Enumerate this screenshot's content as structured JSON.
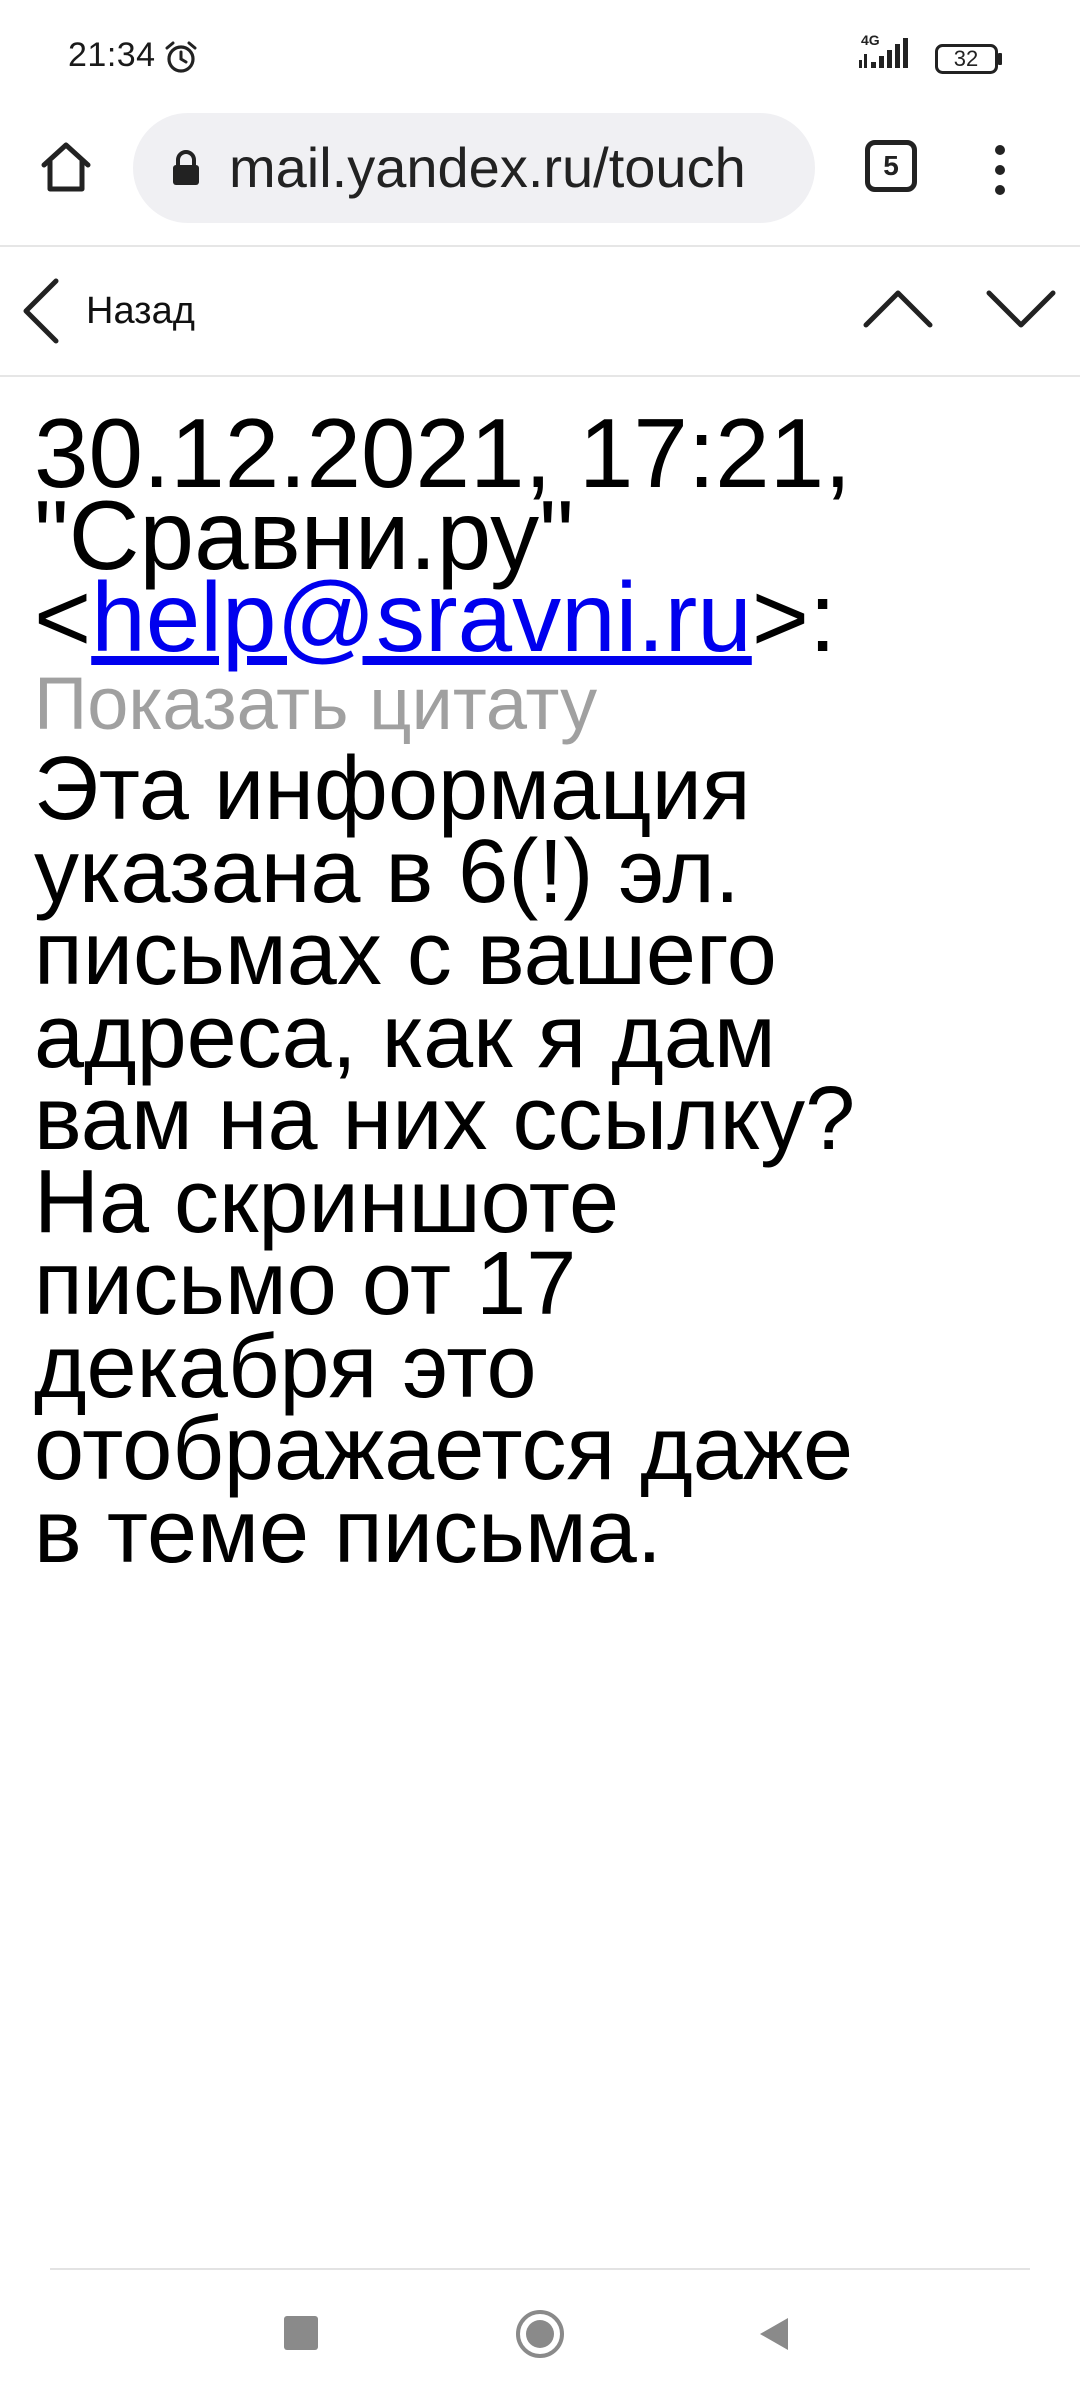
{
  "status_bar": {
    "time": "21:34",
    "network": "4G",
    "battery": "32",
    "alarm_icon": "alarm-clock-icon",
    "signal_icon": "cell-signal-icon"
  },
  "browser": {
    "url": "mail.yandex.ru/touch",
    "tab_count": "5",
    "home_icon": "home-icon",
    "lock_icon": "lock-icon",
    "menu_icon": "more-vertical-icon"
  },
  "mail_nav": {
    "back_label": "Назад",
    "prev_icon": "chevron-up-icon",
    "next_icon": "chevron-down-icon"
  },
  "message": {
    "header_line1": "30.12.2021, 17:21,",
    "header_line2": "\"Сравни.ру\"",
    "email_open": "<",
    "email": "help@sravni.ru",
    "email_close": ">:",
    "show_quote": "Показать цитату",
    "body_lines": [
      "Эта информация",
      "указана в 6(!) эл.",
      "письмах с вашего",
      "адреса, как я дам",
      "вам на них ссылку?",
      "На скриншоте",
      "письмо от 17",
      "декабря это",
      "отображается даже",
      "в теме письма."
    ]
  },
  "system_nav": {
    "recents_icon": "square-recents-icon",
    "home_icon": "circle-home-icon",
    "back_icon": "triangle-back-icon"
  },
  "colors": {
    "link": "#0000ee",
    "muted": "#a0a0a0",
    "url_bar_bg": "#f0f0f3"
  }
}
